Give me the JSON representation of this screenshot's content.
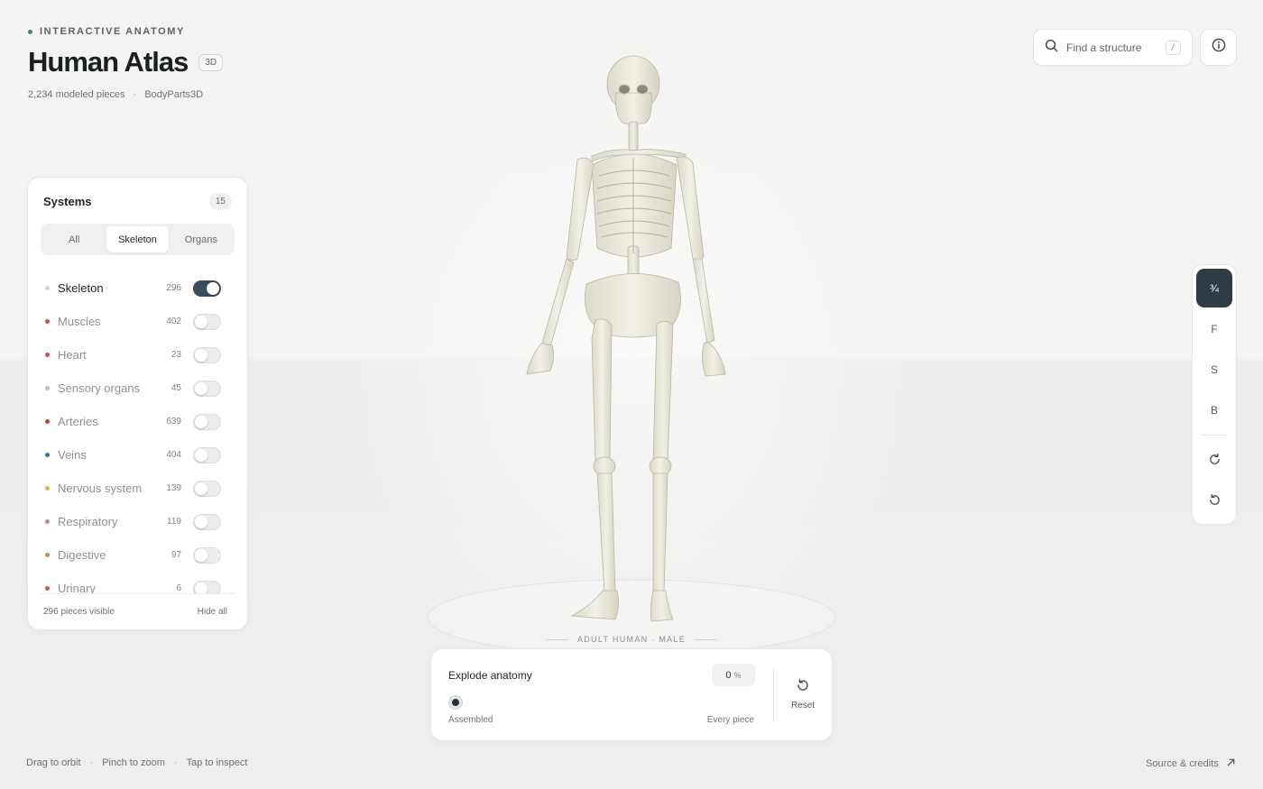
{
  "header": {
    "eyebrow": "INTERACTIVE ANATOMY",
    "title": "Human Atlas",
    "badge": "3D",
    "pieces": "2,234 modeled pieces",
    "source": "BodyParts3D"
  },
  "search": {
    "placeholder": "Find a structure",
    "shortcut": "/"
  },
  "systems": {
    "title": "Systems",
    "count": "15",
    "tabs": [
      {
        "label": "All",
        "active": false
      },
      {
        "label": "Skeleton",
        "active": true
      },
      {
        "label": "Organs",
        "active": false
      }
    ],
    "items": [
      {
        "label": "Skeleton",
        "count": "296",
        "color": "#d9d6c1",
        "on": true
      },
      {
        "label": "Muscles",
        "count": "402",
        "color": "#b5574f",
        "on": false
      },
      {
        "label": "Heart",
        "count": "23",
        "color": "#b3545a",
        "on": false
      },
      {
        "label": "Sensory organs",
        "count": "45",
        "color": "#a9c3c6",
        "on": false
      },
      {
        "label": "Arteries",
        "count": "639",
        "color": "#b8483e",
        "on": false
      },
      {
        "label": "Veins",
        "count": "404",
        "color": "#3d6f99",
        "on": false
      },
      {
        "label": "Nervous system",
        "count": "139",
        "color": "#e0b25a",
        "on": false
      },
      {
        "label": "Respiratory",
        "count": "119",
        "color": "#c5838d",
        "on": false
      },
      {
        "label": "Digestive",
        "count": "97",
        "color": "#c98a5e",
        "on": false
      },
      {
        "label": "Urinary",
        "count": "6",
        "color": "#b46a4f",
        "on": false
      }
    ],
    "visible": "296 pieces visible",
    "hide_all": "Hide all"
  },
  "views": {
    "buttons": [
      {
        "label": "¾",
        "active": true
      },
      {
        "label": "F",
        "active": false
      },
      {
        "label": "S",
        "active": false
      },
      {
        "label": "B",
        "active": false
      }
    ]
  },
  "stage": {
    "label": "ADULT HUMAN · MALE"
  },
  "explode": {
    "title": "Explode anatomy",
    "value": "0",
    "unit": "%",
    "value_fraction": 0,
    "min_label": "Assembled",
    "max_label": "Every piece",
    "reset_label": "Reset"
  },
  "footer": {
    "hints": [
      "Drag to orbit",
      "Pinch to zoom",
      "Tap to inspect"
    ],
    "credits": "Source & credits"
  },
  "colors": {
    "accent": "#2f3b45",
    "brand_dot": "#3f8a6c",
    "bone": "#ecebdf"
  }
}
